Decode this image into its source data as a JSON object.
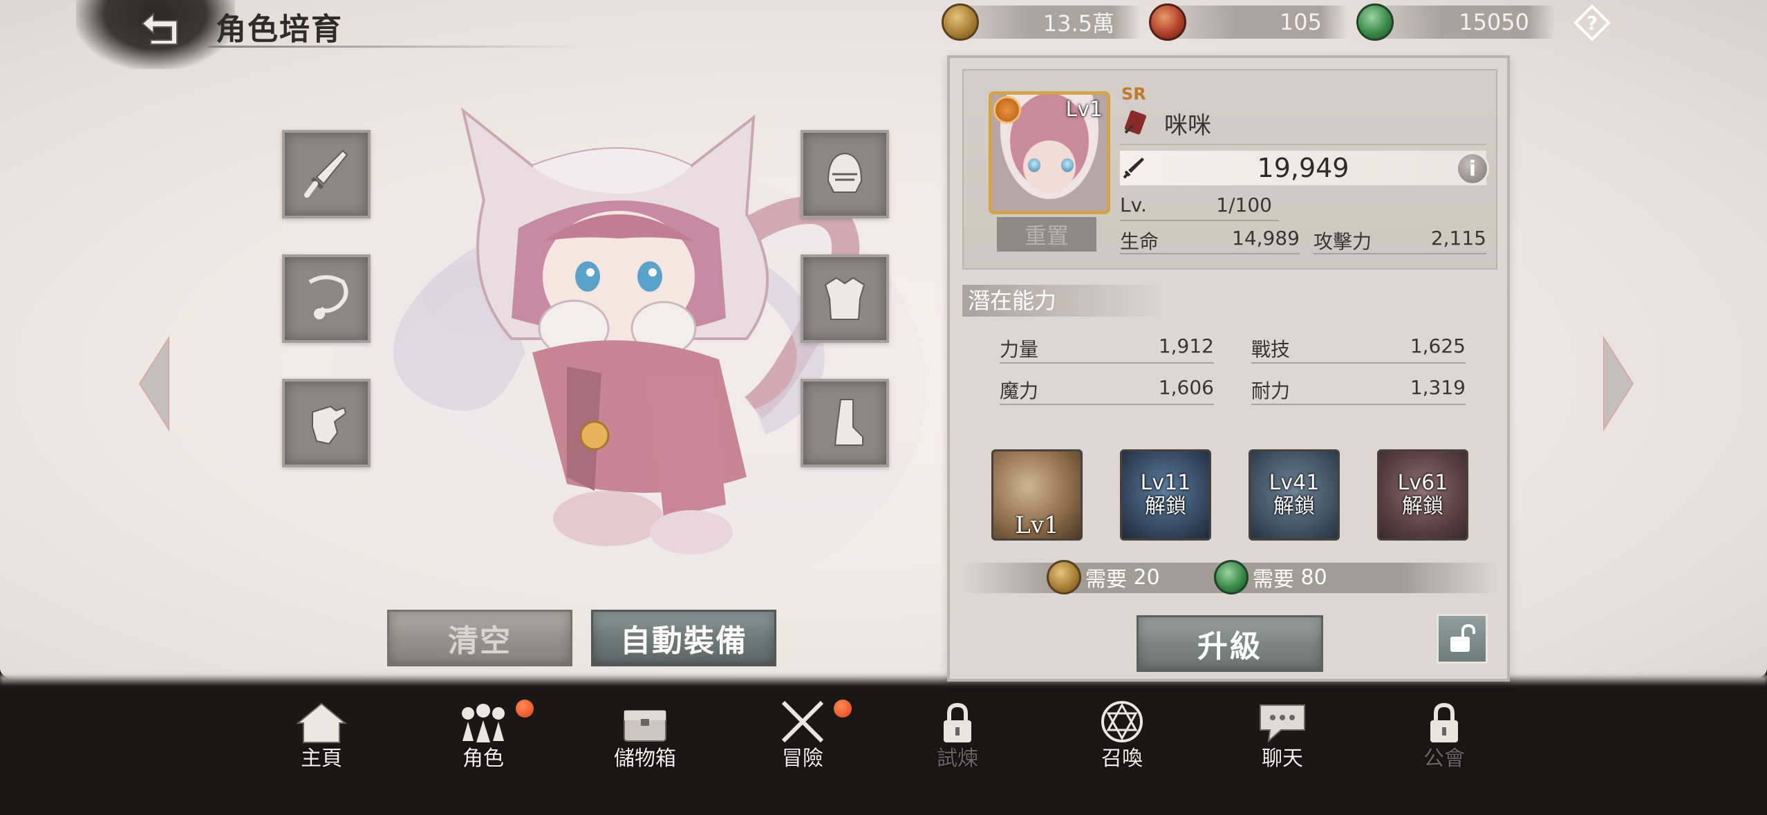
{
  "header": {
    "title": "角色培育",
    "currencies": [
      {
        "name": "gold-coin",
        "value": "13.5萬",
        "color": "#a27a2f"
      },
      {
        "name": "red-orb",
        "value": "105",
        "color": "#b2402a"
      },
      {
        "name": "green-orb",
        "value": "15050",
        "color": "#3b8a4a"
      }
    ],
    "help_icon": "question-diamond-icon"
  },
  "equipment": {
    "left": [
      "sword-icon",
      "necklace-icon",
      "glove-icon"
    ],
    "right": [
      "helmet-icon",
      "armor-icon",
      "boot-icon"
    ]
  },
  "actions": {
    "clear_label": "清空",
    "auto_equip_label": "自動裝備"
  },
  "character": {
    "level_badge": "Lv1",
    "rarity": "SR",
    "name": "咪咪",
    "power": "19,949",
    "reset_label": "重置",
    "lv_label": "Lv.",
    "lv_value": "1/100",
    "hp_label": "生命",
    "hp_value": "14,989",
    "atk_label": "攻擊力",
    "atk_value": "2,115"
  },
  "potential": {
    "title": "潛在能力",
    "stats": [
      {
        "label": "力量",
        "value": "1,912"
      },
      {
        "label": "戰技",
        "value": "1,625"
      },
      {
        "label": "魔力",
        "value": "1,606"
      },
      {
        "label": "耐力",
        "value": "1,319"
      }
    ]
  },
  "skills": [
    {
      "line1": "Lv1",
      "line2": ""
    },
    {
      "line1": "Lv11",
      "line2": "解鎖"
    },
    {
      "line1": "Lv41",
      "line2": "解鎖"
    },
    {
      "line1": "Lv61",
      "line2": "解鎖"
    }
  ],
  "requirements": [
    {
      "label": "需要",
      "value": "20",
      "currency": "gold-coin"
    },
    {
      "label": "需要",
      "value": "80",
      "currency": "green-orb"
    }
  ],
  "upgrade_label": "升級",
  "nav": [
    {
      "label": "主頁",
      "icon": "home-icon",
      "locked": false,
      "badge": false
    },
    {
      "label": "角色",
      "icon": "characters-icon",
      "locked": false,
      "badge": true
    },
    {
      "label": "儲物箱",
      "icon": "chest-icon",
      "locked": false,
      "badge": false
    },
    {
      "label": "冒險",
      "icon": "crossed-swords-icon",
      "locked": false,
      "badge": true
    },
    {
      "label": "試煉",
      "icon": "lock-icon",
      "locked": true,
      "badge": false
    },
    {
      "label": "召喚",
      "icon": "summon-circle-icon",
      "locked": false,
      "badge": false
    },
    {
      "label": "聊天",
      "icon": "chat-icon",
      "locked": false,
      "badge": false
    },
    {
      "label": "公會",
      "icon": "lock-icon",
      "locked": true,
      "badge": false
    }
  ]
}
